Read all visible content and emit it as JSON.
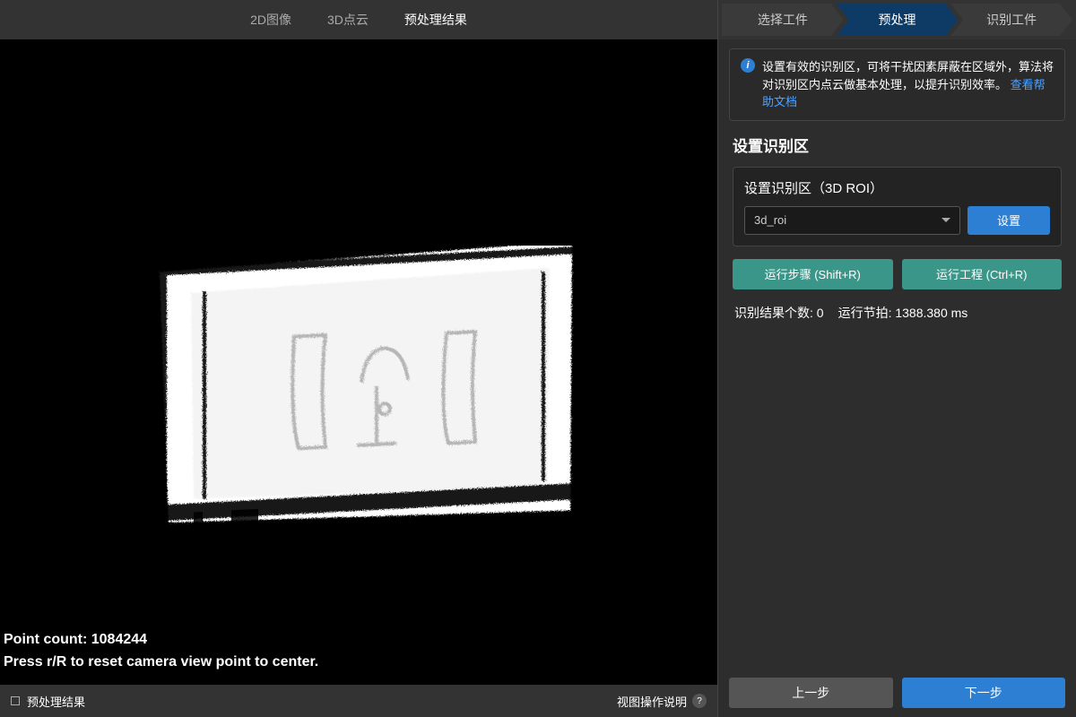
{
  "tabs": {
    "image2d": "2D图像",
    "points3d": "3D点云",
    "preprocess": "预处理结果"
  },
  "viewport": {
    "pointCountLabel": "Point count: 1084244",
    "resetHint": "Press r/R to reset camera view point to center."
  },
  "statusBar": {
    "label": "预处理结果",
    "viewHelp": "视图操作说明",
    "helpBadge": "?"
  },
  "steps": {
    "select": "选择工件",
    "preprocess": "预处理",
    "recognize": "识别工件"
  },
  "info": {
    "text": "设置有效的识别区，可将干扰因素屏蔽在区域外，算法将对识别区内点云做基本处理，以提升识别效率。",
    "link": "查看帮助文档"
  },
  "section": {
    "title": "设置识别区",
    "panelTitle": "设置识别区（3D ROI）",
    "roiSelected": "3d_roi",
    "setBtn": "设置",
    "runStep": "运行步骤 (Shift+R)",
    "runProject": "运行工程 (Ctrl+R)",
    "resultCountLabel": "识别结果个数: 0",
    "runTimeLabel": "运行节拍: 1388.380 ms"
  },
  "footer": {
    "prev": "上一步",
    "next": "下一步"
  }
}
